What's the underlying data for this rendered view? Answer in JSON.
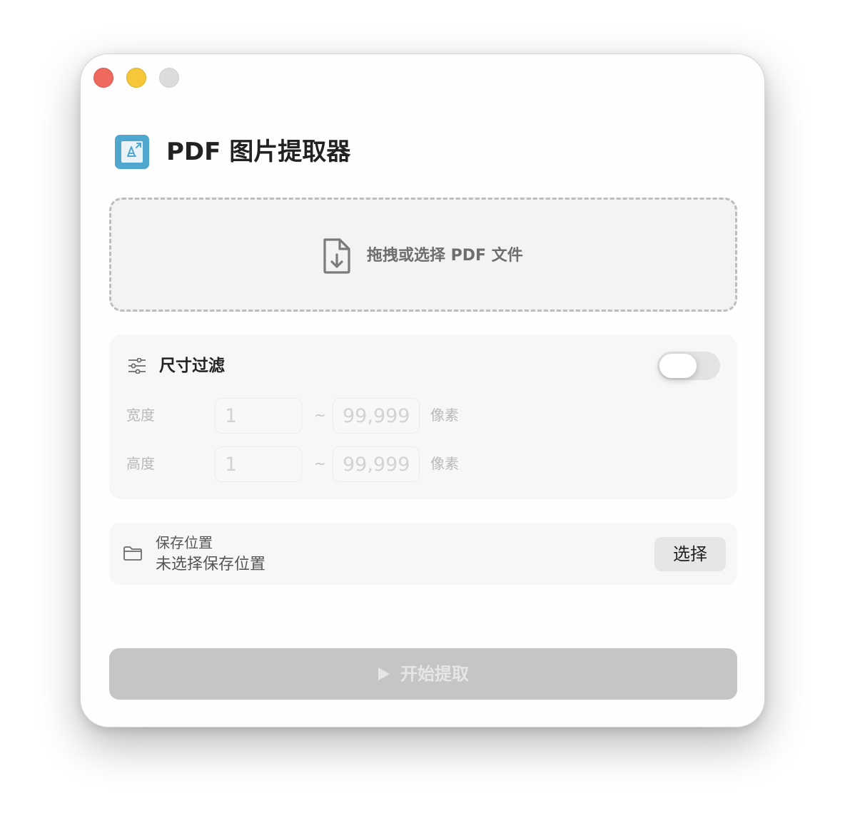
{
  "window": {
    "controls": [
      "close",
      "minimize",
      "maximize"
    ]
  },
  "header": {
    "app_icon": "pdf-icon",
    "title": "PDF 图片提取器"
  },
  "dropzone": {
    "icon": "file-download-icon",
    "text": "拖拽或选择 PDF 文件"
  },
  "size_filter": {
    "icon": "sliders-icon",
    "title": "尺寸过滤",
    "enabled": false,
    "rows": [
      {
        "label": "宽度",
        "min_placeholder": "1",
        "separator": "~",
        "max_placeholder": "99,999",
        "unit": "像素"
      },
      {
        "label": "高度",
        "min_placeholder": "1",
        "separator": "~",
        "max_placeholder": "99,999",
        "unit": "像素"
      }
    ]
  },
  "save_location": {
    "icon": "folder-icon",
    "label": "保存位置",
    "value": "未选择保存位置",
    "button_label": "选择"
  },
  "start": {
    "icon": "play-icon",
    "label": "开始提取",
    "disabled": true
  },
  "colors": {
    "close": "#ee6a5f",
    "minimize": "#f5c739",
    "maximize": "#dcdcdc",
    "app_icon_bg": "#4fa6cf",
    "start_disabled": "#c5c5c7"
  }
}
